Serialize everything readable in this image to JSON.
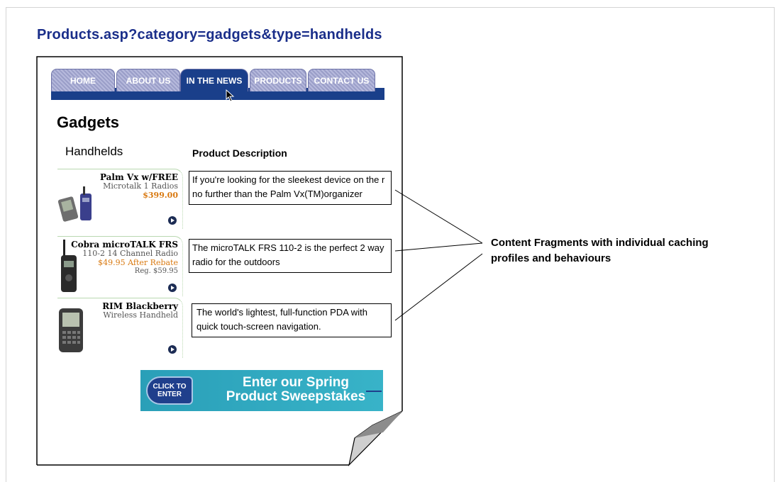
{
  "url_title": "Products.asp?category=gadgets&type=handhelds",
  "nav": {
    "tabs": [
      {
        "label": "HOME"
      },
      {
        "label": "ABOUT US"
      },
      {
        "label": "IN THE NEWS"
      },
      {
        "label": "PRODUCTS"
      },
      {
        "label": "CONTACT US"
      }
    ]
  },
  "page": {
    "title": "Gadgets",
    "subtitle": "Handhelds",
    "description_header": "Product Description"
  },
  "products": [
    {
      "name": "Palm Vx w/FREE",
      "sub": "Microtalk 1 Radios",
      "price": "$399.00",
      "reg": "",
      "description": [
        "If you're looking for the sleekest device on the r",
        "no further than the Palm Vx(TM)organizer"
      ]
    },
    {
      "name": "Cobra microTALK FRS",
      "sub": "110-2 14 Channel Radio",
      "price": "$49.95 After Rebate",
      "reg": "Reg. $59.95",
      "description": [
        "The microTALK FRS 110-2 is the perfect 2 way",
        "radio for the outdoors"
      ]
    },
    {
      "name": "RIM Blackberry",
      "sub": "Wireless Handheld",
      "price": "",
      "reg": "",
      "description": [
        "The world's lightest, full-function PDA with",
        "quick touch-screen navigation."
      ]
    }
  ],
  "banner": {
    "button_line1": "CLICK TO",
    "button_line2": "ENTER",
    "text_line1": "Enter our Spring",
    "text_line2": "Product Sweepstakes"
  },
  "annotation": {
    "line1": "Content Fragments with individual caching",
    "line2": "profiles and behaviours"
  },
  "colors": {
    "url_title": "#1a2e8a",
    "nav_active": "#1a3f8a",
    "price": "#d97a12",
    "banner": "#2a9fb8"
  }
}
